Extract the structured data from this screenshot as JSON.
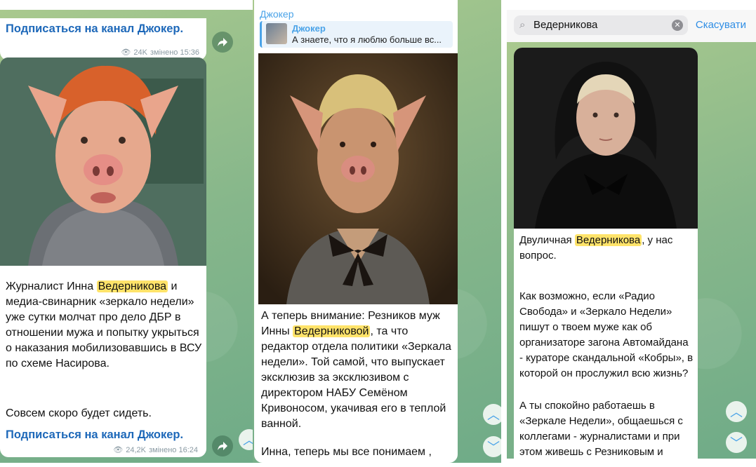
{
  "panel1": {
    "subscribe_top": "Подписаться на канал Джокер.",
    "meta_top_views": "24K",
    "meta_top_time": "змінено 15:36",
    "post_text_1": "Журналист Инна ",
    "post_highlight": "Ведерникова",
    "post_text_2": " и медиа-свинарник «зеркало недели» уже сутки молчат про дело ДБР в отношении мужа и попытку укрыться о наказания мобилизовавшись в ВСУ по схеме Насирова.",
    "post_text_3": "Совсем скоро будет сидеть.",
    "subscribe_bottom": "Подписаться на канал Джокер.",
    "meta_bottom_views": "24,2K",
    "meta_bottom_time": "змінено 16:24"
  },
  "panel2": {
    "channel_name": "Джокер",
    "reply_author": "Джокер",
    "reply_text": "А знаете, что я люблю больше вс...",
    "post_text_1": "А теперь внимание: Резников муж Инны ",
    "post_highlight": "Ведерниковой",
    "post_text_2": ", та что редактор отдела политики «Зеркала недели». Той самой, что выпускает эксклюзив за эксклюзивом с директором НАБУ Семёном Кривоносом, укачивая его в теплой ванной.",
    "post_text_3": "Инна, теперь мы все понимаем ,"
  },
  "panel3": {
    "search_value": "Ведерникова",
    "cancel_label": "Скасувати",
    "post_text_1": "Двуличная ",
    "post_highlight": "Ведерникова",
    "post_text_2": ", у нас вопрос.",
    "post_text_3": "Как возможно, если «Радио Свобода» и «Зеркало Недели» пишут о твоем муже как об организаторе загона Автомайдана - кураторе скандальной «Кобры», в которой он прослужил всю жизнь?",
    "post_text_4": "А ты спокойно работаешь в «Зеркале Недели», общаешься с коллегами - журналистами и при этом живешь с Резниковым и"
  },
  "icons": {
    "share": "share-icon",
    "up": "chevron-up-icon",
    "down": "chevron-down-icon",
    "search": "search-icon",
    "clear": "clear-icon",
    "eye": "eye-icon"
  },
  "colors": {
    "link": "#1d68b9",
    "highlight": "#ffe36a",
    "accent": "#4aa3e8"
  }
}
